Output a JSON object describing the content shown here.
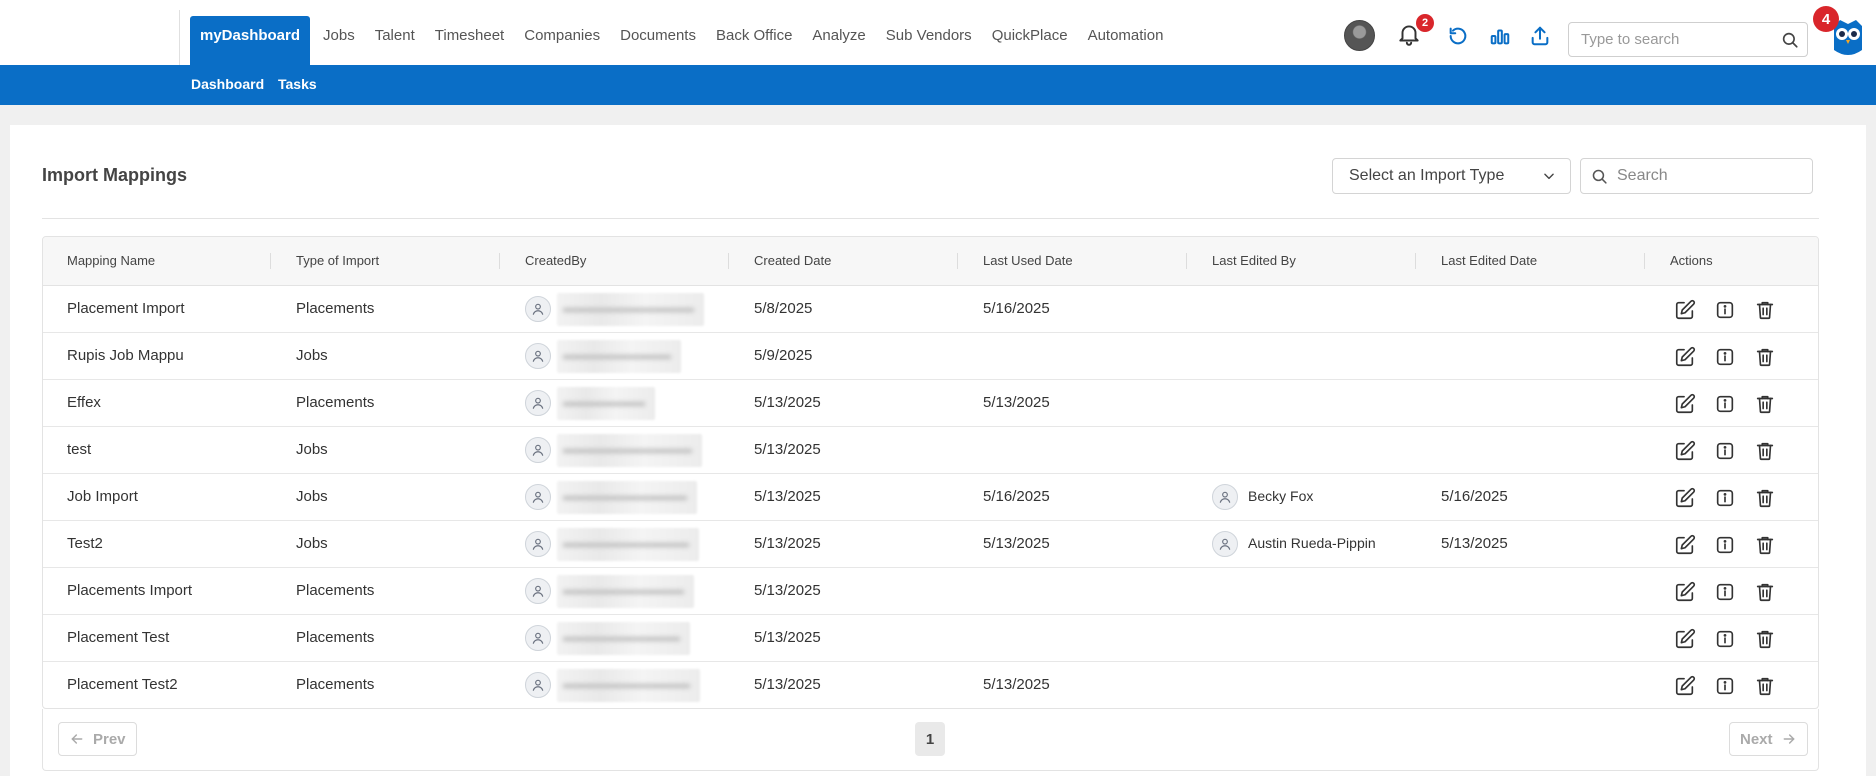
{
  "nav": {
    "items": [
      "myDashboard",
      "Jobs",
      "Talent",
      "Timesheet",
      "Companies",
      "Documents",
      "Back Office",
      "Analyze",
      "Sub Vendors",
      "QuickPlace",
      "Automation"
    ],
    "active": "myDashboard",
    "notification_count": "2",
    "owl_badge_count": "4",
    "search_placeholder": "Type to search",
    "icons": [
      "user-avatar-icon",
      "bell-icon",
      "refresh-icon",
      "bar-chart-icon",
      "upload-icon",
      "search-icon",
      "owl-logo-icon"
    ]
  },
  "subnav": {
    "items": [
      "Dashboard",
      "Tasks"
    ]
  },
  "page": {
    "title": "Import Mappings",
    "import_type_placeholder": "Select an Import Type",
    "search_placeholder": "Search"
  },
  "table": {
    "headers": [
      "Mapping Name",
      "Type of Import",
      "CreatedBy",
      "Created Date",
      "Last Used Date",
      "Last Edited By",
      "Last Edited Date",
      "Actions"
    ],
    "rows": [
      {
        "name": "Placement Import",
        "type": "Placements",
        "created": "5/8/2025",
        "last_used": "5/16/2025",
        "edited_by": "",
        "edited_date": ""
      },
      {
        "name": "Rupis Job Mappu",
        "type": "Jobs",
        "created": "5/9/2025",
        "last_used": "",
        "edited_by": "",
        "edited_date": ""
      },
      {
        "name": "Effex",
        "type": "Placements",
        "created": "5/13/2025",
        "last_used": "5/13/2025",
        "edited_by": "",
        "edited_date": ""
      },
      {
        "name": "test",
        "type": "Jobs",
        "created": "5/13/2025",
        "last_used": "",
        "edited_by": "",
        "edited_date": ""
      },
      {
        "name": "Job Import",
        "type": "Jobs",
        "created": "5/13/2025",
        "last_used": "5/16/2025",
        "edited_by": "Becky Fox",
        "edited_date": "5/16/2025"
      },
      {
        "name": "Test2",
        "type": "Jobs",
        "created": "5/13/2025",
        "last_used": "5/13/2025",
        "edited_by": "Austin Rueda-Pippin",
        "edited_date": "5/13/2025"
      },
      {
        "name": "Placements Import",
        "type": "Placements",
        "created": "5/13/2025",
        "last_used": "",
        "edited_by": "",
        "edited_date": ""
      },
      {
        "name": "Placement Test",
        "type": "Placements",
        "created": "5/13/2025",
        "last_used": "",
        "edited_by": "",
        "edited_date": ""
      },
      {
        "name": "Placement Test2",
        "type": "Placements",
        "created": "5/13/2025",
        "last_used": "5/13/2025",
        "edited_by": "",
        "edited_date": ""
      }
    ],
    "row_actions": [
      "edit-icon",
      "info-icon",
      "trash-icon"
    ]
  },
  "pagination": {
    "prev": "Prev",
    "next": "Next",
    "current_page": "1"
  },
  "colors": {
    "primary": "#0a6ec6",
    "badge": "#d9262b",
    "icon_blue": "#0a6ec6"
  }
}
